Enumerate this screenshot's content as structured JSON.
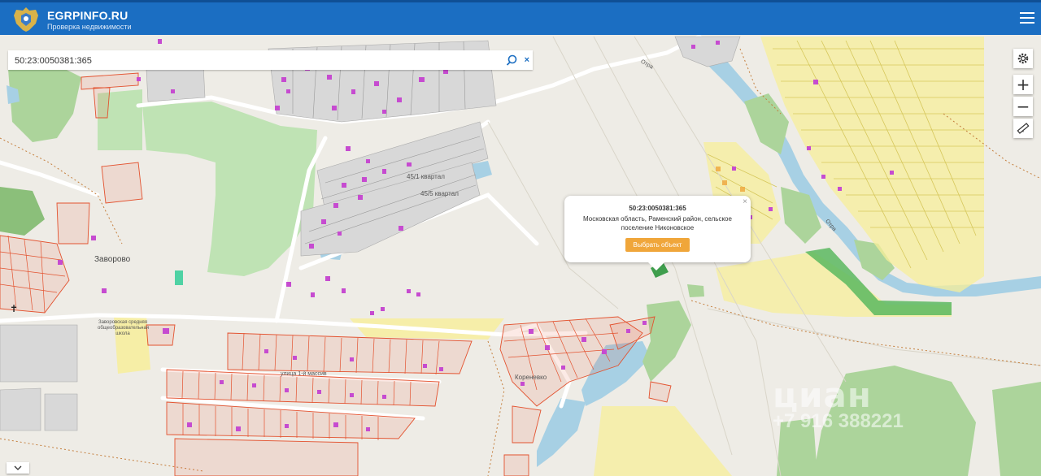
{
  "header": {
    "brand": "EGRPINFO.RU",
    "subtitle": "Проверка недвижимости"
  },
  "search": {
    "value": "50:23:0050381:365",
    "clear_symbol": "×"
  },
  "controls": {
    "zoom_in": "+",
    "zoom_out": "−"
  },
  "popup": {
    "title": "50:23:0050381:365",
    "address": "Московская область, Раменский район, сельское поселение Никоновское",
    "select_button": "Выбрать объект",
    "close_symbol": "×"
  },
  "map_labels": {
    "village": "Заворово",
    "quarter_1": "45/1 квартал",
    "quarter_2": "45/5 квартал",
    "school": "Заворовская средняя общеобразовательная школа",
    "street": "улица 1-й массив",
    "village_2": "Кореневко",
    "river": "Отра",
    "river_2": "Отра"
  },
  "watermark": {
    "name": "циан",
    "phone": "+7 916 388221"
  },
  "colors": {
    "header": "#1b6ec2",
    "map_base": "#eeece6",
    "forest": "#acd49b",
    "water": "#a7d0e4",
    "parcel_outline": "#e3522f",
    "building": "#c64bd0",
    "highlight_yellow": "#f7ef9a",
    "button": "#f0a63a"
  },
  "icons": {
    "logo": "coat-of-arms-icon",
    "menu": "hamburger-icon",
    "search": "search-icon",
    "settings": "gear-icon",
    "ruler": "ruler-icon",
    "collapse": "chevron-down-icon"
  }
}
